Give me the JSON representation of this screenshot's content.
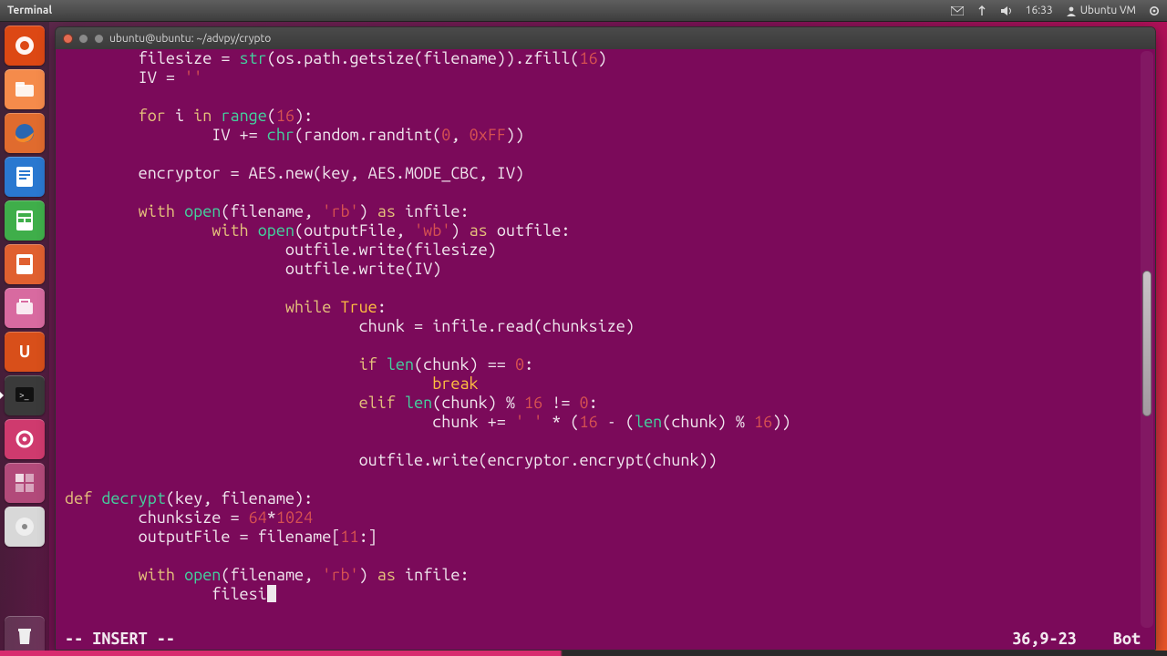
{
  "panel": {
    "app_label": "Terminal",
    "time": "16:33",
    "user": "Ubuntu VM"
  },
  "window": {
    "title": "ubuntu@ubuntu: ~/advpy/crypto"
  },
  "launcher": {
    "items": [
      {
        "name": "dash",
        "color": "#dd4814"
      },
      {
        "name": "files",
        "color": "#f58b4b"
      },
      {
        "name": "firefox",
        "color": "#e06b2e"
      },
      {
        "name": "writer",
        "color": "#2a78d0"
      },
      {
        "name": "calc",
        "color": "#3fae4a"
      },
      {
        "name": "impress",
        "color": "#e06030"
      },
      {
        "name": "software-center",
        "color": "#d86aa0"
      },
      {
        "name": "ubuntu-one",
        "color": "#d84f1a"
      },
      {
        "name": "terminal",
        "color": "#3a3a3a",
        "running": true
      },
      {
        "name": "settings",
        "color": "#cf3a6e"
      },
      {
        "name": "workspaces",
        "color": "#b24a7a"
      },
      {
        "name": "disc",
        "color": "#d8d8d8"
      }
    ],
    "trash": {
      "name": "trash",
      "color": "#cfcfcf"
    }
  },
  "vim": {
    "mode": "-- INSERT --",
    "ruler": "36,9-23",
    "pos": "Bot"
  },
  "code_lines": [
    {
      "indent": 8,
      "tokens": [
        {
          "t": "filesize = "
        },
        {
          "t": "str",
          "c": "fn"
        },
        {
          "t": "(os.path.getsize(filename)).zfill("
        },
        {
          "t": "16",
          "c": "num"
        },
        {
          "t": ")"
        }
      ]
    },
    {
      "indent": 8,
      "tokens": [
        {
          "t": "IV = "
        },
        {
          "t": "''",
          "c": "str"
        }
      ]
    },
    {
      "indent": 0,
      "tokens": []
    },
    {
      "indent": 8,
      "tokens": [
        {
          "t": "for",
          "c": "kw"
        },
        {
          "t": " i "
        },
        {
          "t": "in",
          "c": "kw"
        },
        {
          "t": " "
        },
        {
          "t": "range",
          "c": "fn"
        },
        {
          "t": "("
        },
        {
          "t": "16",
          "c": "num"
        },
        {
          "t": "):"
        }
      ]
    },
    {
      "indent": 16,
      "tokens": [
        {
          "t": "IV += "
        },
        {
          "t": "chr",
          "c": "fn"
        },
        {
          "t": "(random.randint("
        },
        {
          "t": "0",
          "c": "num"
        },
        {
          "t": ", "
        },
        {
          "t": "0xFF",
          "c": "num"
        },
        {
          "t": "))"
        }
      ]
    },
    {
      "indent": 0,
      "tokens": []
    },
    {
      "indent": 8,
      "tokens": [
        {
          "t": "encryptor = AES.new(key, AES.MODE_CBC, IV)"
        }
      ]
    },
    {
      "indent": 0,
      "tokens": []
    },
    {
      "indent": 8,
      "tokens": [
        {
          "t": "with",
          "c": "kw"
        },
        {
          "t": " "
        },
        {
          "t": "open",
          "c": "fn"
        },
        {
          "t": "(filename, "
        },
        {
          "t": "'rb'",
          "c": "str"
        },
        {
          "t": ") "
        },
        {
          "t": "as",
          "c": "kw"
        },
        {
          "t": " infile:"
        }
      ]
    },
    {
      "indent": 16,
      "tokens": [
        {
          "t": "with",
          "c": "kw"
        },
        {
          "t": " "
        },
        {
          "t": "open",
          "c": "fn"
        },
        {
          "t": "(outputFile, "
        },
        {
          "t": "'wb'",
          "c": "str"
        },
        {
          "t": ") "
        },
        {
          "t": "as",
          "c": "kw"
        },
        {
          "t": " outfile:"
        }
      ]
    },
    {
      "indent": 24,
      "tokens": [
        {
          "t": "outfile.write(filesize)"
        }
      ]
    },
    {
      "indent": 24,
      "tokens": [
        {
          "t": "outfile.write(IV)"
        }
      ]
    },
    {
      "indent": 0,
      "tokens": []
    },
    {
      "indent": 24,
      "tokens": [
        {
          "t": "while",
          "c": "kw"
        },
        {
          "t": " "
        },
        {
          "t": "True",
          "c": "bool"
        },
        {
          "t": ":"
        }
      ]
    },
    {
      "indent": 32,
      "tokens": [
        {
          "t": "chunk = infile.read(chunksize)"
        }
      ]
    },
    {
      "indent": 0,
      "tokens": []
    },
    {
      "indent": 32,
      "tokens": [
        {
          "t": "if",
          "c": "kw"
        },
        {
          "t": " "
        },
        {
          "t": "len",
          "c": "fn"
        },
        {
          "t": "(chunk) == "
        },
        {
          "t": "0",
          "c": "num"
        },
        {
          "t": ":"
        }
      ]
    },
    {
      "indent": 40,
      "tokens": [
        {
          "t": "break",
          "c": "bool"
        }
      ]
    },
    {
      "indent": 32,
      "tokens": [
        {
          "t": "elif",
          "c": "kw"
        },
        {
          "t": " "
        },
        {
          "t": "len",
          "c": "fn"
        },
        {
          "t": "(chunk) % "
        },
        {
          "t": "16",
          "c": "num"
        },
        {
          "t": " != "
        },
        {
          "t": "0",
          "c": "num"
        },
        {
          "t": ":"
        }
      ]
    },
    {
      "indent": 40,
      "tokens": [
        {
          "t": "chunk += "
        },
        {
          "t": "' '",
          "c": "str"
        },
        {
          "t": " * ("
        },
        {
          "t": "16",
          "c": "num"
        },
        {
          "t": " - ("
        },
        {
          "t": "len",
          "c": "fn"
        },
        {
          "t": "(chunk) % "
        },
        {
          "t": "16",
          "c": "num"
        },
        {
          "t": "))"
        }
      ]
    },
    {
      "indent": 0,
      "tokens": []
    },
    {
      "indent": 32,
      "tokens": [
        {
          "t": "outfile.write(encryptor.encrypt(chunk))"
        }
      ]
    },
    {
      "indent": 0,
      "tokens": []
    },
    {
      "indent": 0,
      "tokens": [
        {
          "t": "def",
          "c": "kw"
        },
        {
          "t": " "
        },
        {
          "t": "decrypt",
          "c": "fn"
        },
        {
          "t": "(key, filename):"
        }
      ]
    },
    {
      "indent": 8,
      "tokens": [
        {
          "t": "chunksize = "
        },
        {
          "t": "64",
          "c": "num"
        },
        {
          "t": "*"
        },
        {
          "t": "1024",
          "c": "num"
        }
      ]
    },
    {
      "indent": 8,
      "tokens": [
        {
          "t": "outputFile = filename["
        },
        {
          "t": "11",
          "c": "num"
        },
        {
          "t": ":]"
        }
      ]
    },
    {
      "indent": 0,
      "tokens": []
    },
    {
      "indent": 8,
      "tokens": [
        {
          "t": "with",
          "c": "kw"
        },
        {
          "t": " "
        },
        {
          "t": "open",
          "c": "fn"
        },
        {
          "t": "(filename, "
        },
        {
          "t": "'rb'",
          "c": "str"
        },
        {
          "t": ") "
        },
        {
          "t": "as",
          "c": "kw"
        },
        {
          "t": " infile:"
        }
      ]
    },
    {
      "indent": 16,
      "tokens": [
        {
          "t": "filesi"
        },
        {
          "cursor": true
        }
      ]
    }
  ]
}
